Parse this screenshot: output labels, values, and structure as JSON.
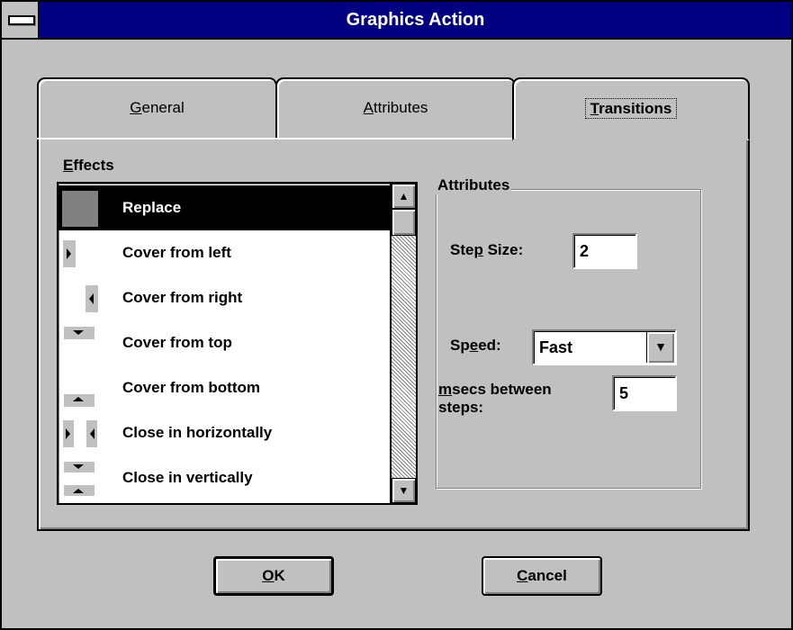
{
  "window": {
    "title": "Graphics Action"
  },
  "tabs": [
    {
      "label": "General",
      "mnemonic": "G",
      "rest": "eneral"
    },
    {
      "label": "Attributes",
      "mnemonic": "A",
      "rest": "ttributes"
    },
    {
      "label": "Transitions",
      "mnemonic": "T",
      "rest": "ransitions",
      "selected": true
    }
  ],
  "effects": {
    "label": "Effects",
    "mnemonic": "E",
    "rest": "ffects",
    "items": [
      {
        "label": "Replace",
        "icon": "replace-icon",
        "selected": true
      },
      {
        "label": "Cover from left",
        "icon": "cover-left-icon"
      },
      {
        "label": "Cover from right",
        "icon": "cover-right-icon"
      },
      {
        "label": "Cover from top",
        "icon": "cover-top-icon"
      },
      {
        "label": "Cover from bottom",
        "icon": "cover-bottom-icon"
      },
      {
        "label": "Close in horizontally",
        "icon": "close-horizontal-icon"
      },
      {
        "label": "Close in vertically",
        "icon": "close-vertical-icon"
      }
    ]
  },
  "attributes": {
    "title": "Attributes",
    "step_size": {
      "pre": "Ste",
      "mnemonic": "p",
      "post": " Size:",
      "value": "2"
    },
    "speed": {
      "pre": "Sp",
      "mnemonic": "e",
      "post": "ed:",
      "value": "Fast"
    },
    "msecs": {
      "mnemonic": "m",
      "line1_rest": "secs between",
      "line2": "steps:",
      "value": "5"
    }
  },
  "buttons": {
    "ok": {
      "label": "OK",
      "mnemonic": "O",
      "rest": "K"
    },
    "cancel": {
      "label": "Cancel",
      "mnemonic": "C",
      "rest": "ancel"
    }
  },
  "colors": {
    "titlebar": "#000080",
    "face": "#c0c0c0",
    "selection": "#000000"
  }
}
